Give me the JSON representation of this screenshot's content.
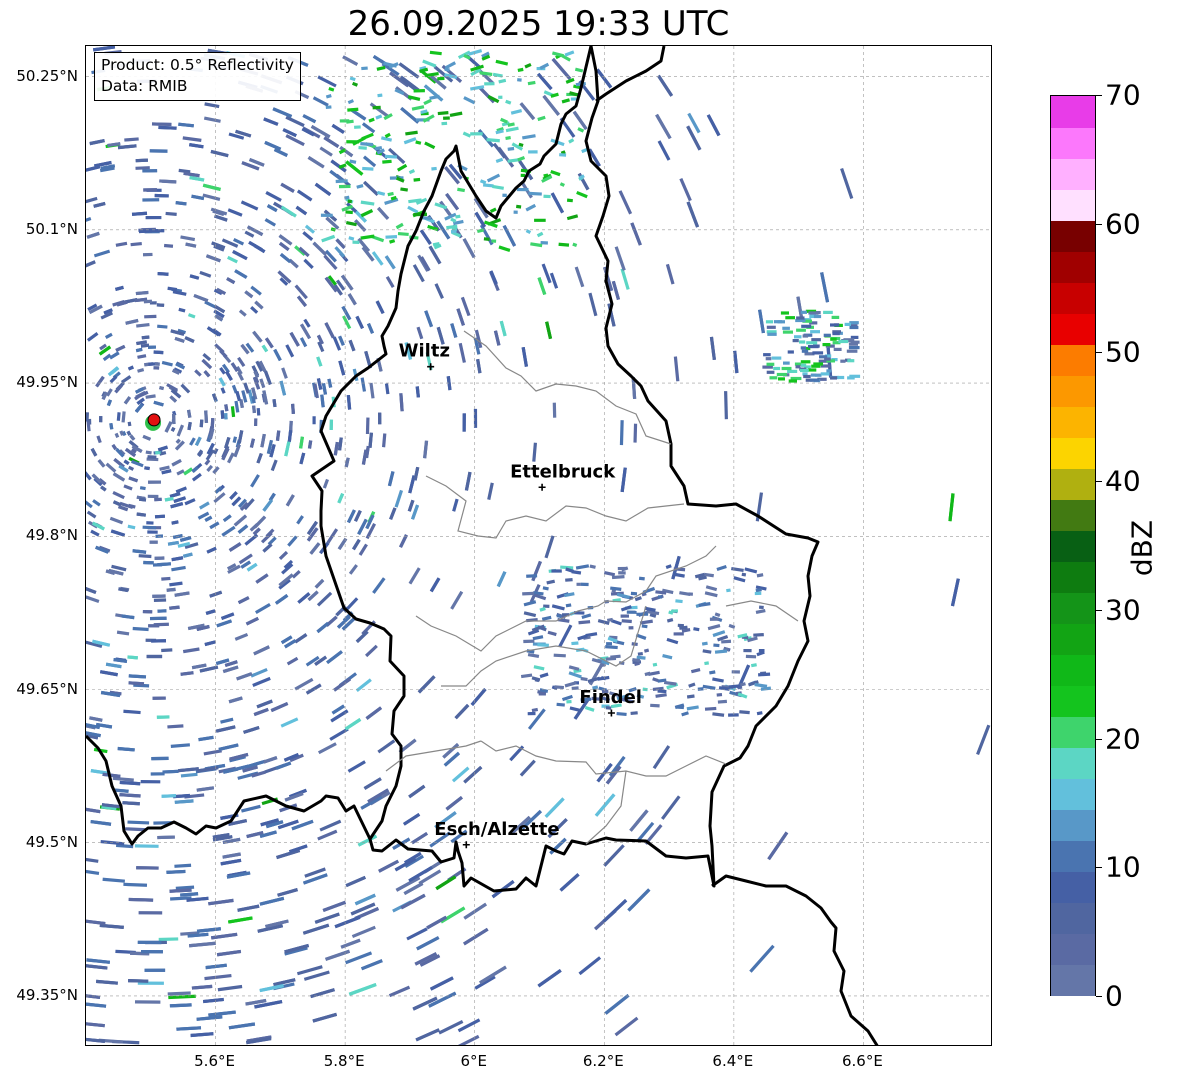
{
  "title": "26.09.2025 19:33 UTC",
  "info_box": {
    "product": "Product: 0.5° Reflectivity",
    "data": "Data: RMIB"
  },
  "map": {
    "lon_range": [
      5.4,
      6.8
    ],
    "lat_range": [
      49.3,
      50.28
    ],
    "lat_ticks": [
      {
        "value": 50.25,
        "label": "50.25°N"
      },
      {
        "value": 50.1,
        "label": "50.1°N"
      },
      {
        "value": 49.95,
        "label": "49.95°N"
      },
      {
        "value": 49.8,
        "label": "49.8°N"
      },
      {
        "value": 49.65,
        "label": "49.65°N"
      },
      {
        "value": 49.5,
        "label": "49.5°N"
      },
      {
        "value": 49.35,
        "label": "49.35°N"
      }
    ],
    "lon_ticks": [
      {
        "value": 5.6,
        "label": "5.6°E"
      },
      {
        "value": 5.8,
        "label": "5.8°E"
      },
      {
        "value": 6.0,
        "label": "6°E"
      },
      {
        "value": 6.2,
        "label": "6.2°E"
      },
      {
        "value": 6.4,
        "label": "6.4°E"
      },
      {
        "value": 6.6,
        "label": "6.6°E"
      }
    ],
    "gridlines": true,
    "radar_site": {
      "lon": 5.505,
      "lat": 49.914
    },
    "cities": [
      {
        "name": "Wiltz",
        "lon": 5.932,
        "lat": 49.966
      },
      {
        "name": "Ettelbruck",
        "lon": 6.104,
        "lat": 49.848
      },
      {
        "name": "Findel",
        "lon": 6.211,
        "lat": 49.627
      },
      {
        "name": "Esch/Alzette",
        "lon": 5.987,
        "lat": 49.498
      }
    ]
  },
  "colorbar": {
    "label": "dBZ",
    "min": 0,
    "max": 70,
    "ticks": [
      {
        "value": 0,
        "label": "0"
      },
      {
        "value": 10,
        "label": "10"
      },
      {
        "value": 20,
        "label": "20"
      },
      {
        "value": 30,
        "label": "30"
      },
      {
        "value": 40,
        "label": "40"
      },
      {
        "value": 50,
        "label": "50"
      },
      {
        "value": 60,
        "label": "60"
      },
      {
        "value": 70,
        "label": "70"
      }
    ],
    "colors": [
      "#6476a8",
      "#5a6aa3",
      "#5066a0",
      "#4560a5",
      "#4a74b0",
      "#5898c8",
      "#62c0dc",
      "#5cd6c4",
      "#3ed46c",
      "#14c41e",
      "#10b818",
      "#12a414",
      "#149418",
      "#0e7c10",
      "#086014",
      "#427a12",
      "#b0b010",
      "#fcd400",
      "#fcb400",
      "#fc9800",
      "#fc7c00",
      "#e80000",
      "#c80000",
      "#a00000",
      "#780000",
      "#ffe0ff",
      "#ffb0ff",
      "#fc78fc",
      "#e83ce8"
    ],
    "accent": "#000000"
  }
}
